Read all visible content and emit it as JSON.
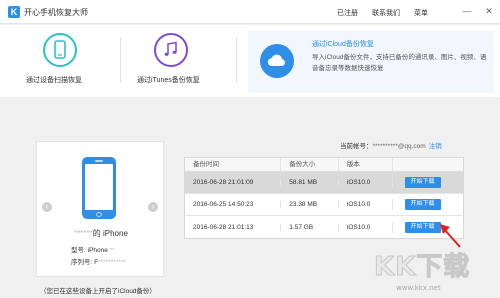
{
  "app": {
    "logo_letter": "K",
    "title": "开心手机恢复大师",
    "links": [
      "已注册",
      "联系我们",
      "菜单"
    ],
    "controls": [
      "—",
      "✕"
    ]
  },
  "modes": [
    {
      "label": "通过设备扫描恢复",
      "icon": "phone-icon",
      "color": "#2dc0c8"
    },
    {
      "label": "通过iTunes备份恢复",
      "icon": "music-note-icon",
      "color": "#7b4cd6"
    },
    {
      "label": "通过iCloud备份恢复",
      "icon": "cloud-icon",
      "color": "#2e8ee8",
      "active": true,
      "description": "导入iCloud备份文件，支持已备份的通讯录、图片、视频、语音备忘录等数据快速恢复"
    }
  ],
  "account": {
    "label": "当前帐号：",
    "value": "**********@qq.com",
    "logout": "注销"
  },
  "device": {
    "name_prefix": "******",
    "name": "的 iPhone",
    "model_label": "型号:",
    "model_value": "iPhone",
    "model_blur": "**",
    "serial_label": "序列号:",
    "serial_value": "F",
    "serial_blur": "***********",
    "nav_prev": "‹",
    "nav_next": "›"
  },
  "footnote": "（您已在这些设备上开启了iCloud备份）",
  "table": {
    "headers": [
      "备份时间",
      "备份大小",
      "版本",
      ""
    ],
    "rows": [
      {
        "time": "2016-06-28 21:01:09",
        "size": "58.81 MB",
        "version": "iOS10.0",
        "action": "开始下载",
        "selected": true
      },
      {
        "time": "2016-06-25 14:50:23",
        "size": "23.38 MB",
        "version": "iOS10.0",
        "action": "开始下载",
        "selected": false
      },
      {
        "time": "2016-06-28 21:01:13",
        "size": "1.57 GB",
        "version": "iOS10.0",
        "action": "开始下载",
        "selected": false
      }
    ]
  },
  "watermark": {
    "logo": "KK下载",
    "url": "www.kkx.net"
  },
  "colors": {
    "accent": "#2e8ee8",
    "pointer_arrow": "#e02020"
  }
}
